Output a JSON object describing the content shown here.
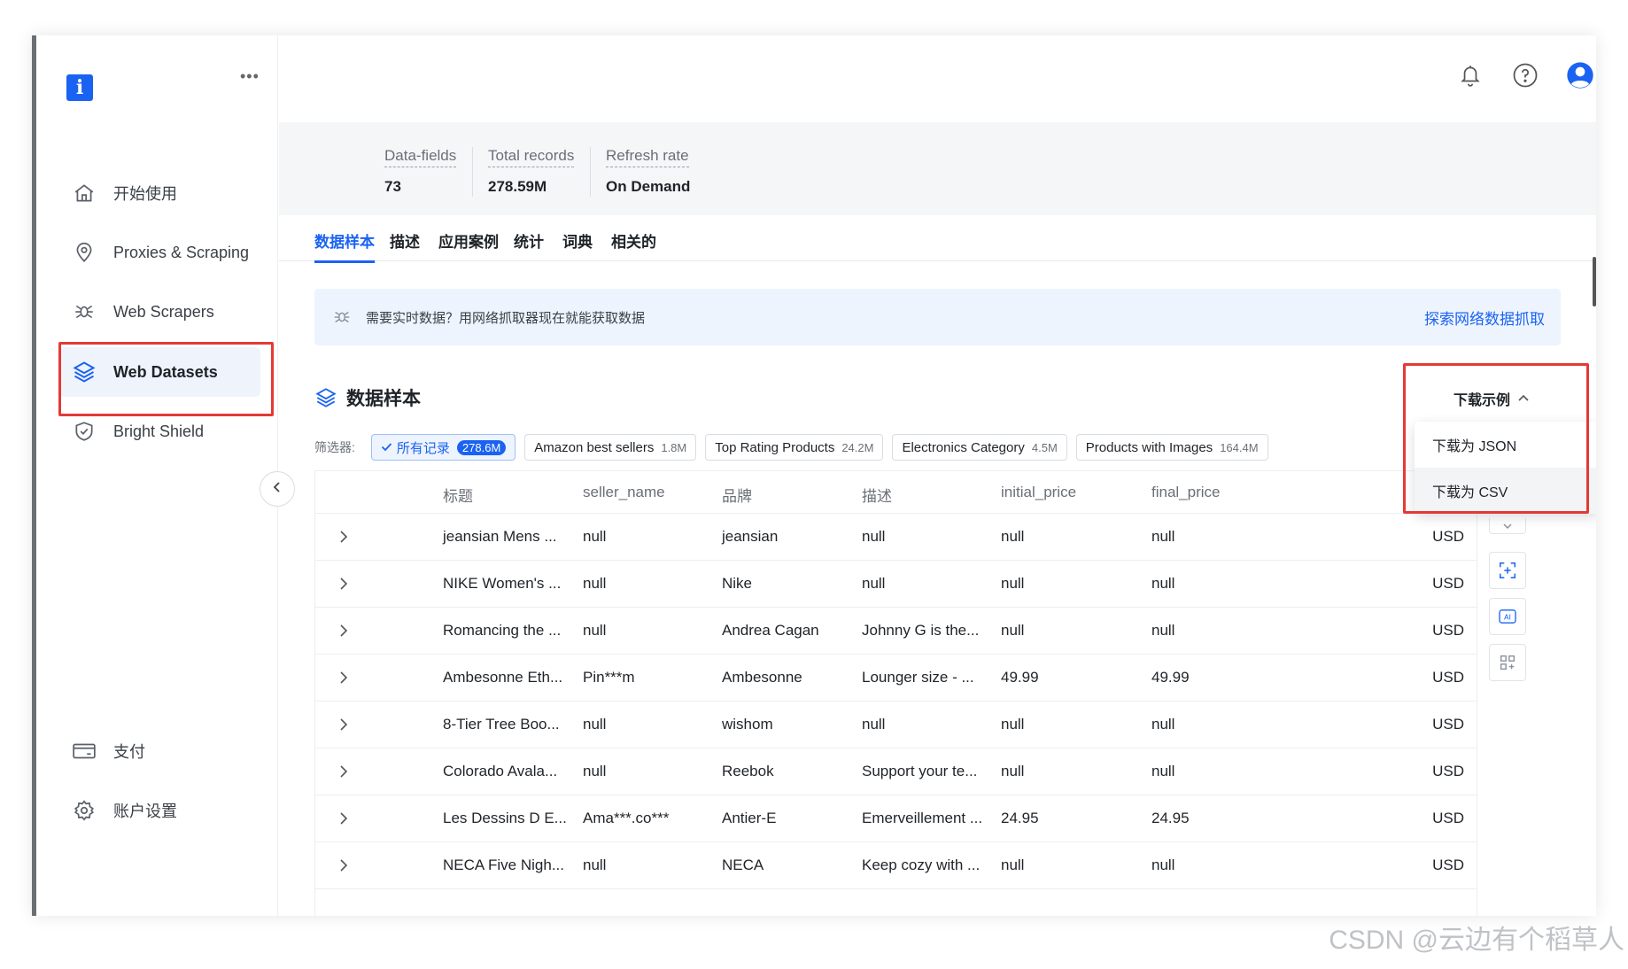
{
  "sidebar": {
    "logo": "i",
    "more": "•••",
    "items": [
      {
        "label": "开始使用",
        "icon": "home-icon"
      },
      {
        "label": "Proxies & Scraping",
        "icon": "location-pin-icon"
      },
      {
        "label": "Web Scrapers",
        "icon": "spider-icon"
      },
      {
        "label": "Web Datasets",
        "icon": "layers-icon",
        "active": true
      },
      {
        "label": "Bright Shield",
        "icon": "shield-check-icon"
      },
      {
        "label": "支付",
        "icon": "card-icon"
      },
      {
        "label": "账户设置",
        "icon": "gear-icon"
      }
    ]
  },
  "topbar": {
    "icons": [
      "bell-icon",
      "help-circle-icon",
      "user-avatar-icon"
    ]
  },
  "stats": [
    {
      "label": "Data-fields",
      "value": "73"
    },
    {
      "label": "Total records",
      "value": "278.59M"
    },
    {
      "label": "Refresh rate",
      "value": "On Demand"
    }
  ],
  "tabs": [
    {
      "label": "数据样本",
      "active": true
    },
    {
      "label": "描述"
    },
    {
      "label": "应用案例"
    },
    {
      "label": "统计"
    },
    {
      "label": "词典"
    },
    {
      "label": "相关的"
    }
  ],
  "banner": {
    "text": "需要实时数据？用网络抓取器现在就能获取数据",
    "link": "探索网络数据抓取"
  },
  "section": {
    "title": "数据样本"
  },
  "download": {
    "label": "下载示例",
    "options": [
      "下载为 JSON",
      "下载为 CSV"
    ]
  },
  "filters": {
    "label": "筛选器:",
    "chips": [
      {
        "label": "所有记录",
        "count": "278.6M",
        "active": true
      },
      {
        "label": "Amazon best sellers",
        "count": "1.8M"
      },
      {
        "label": "Top Rating Products",
        "count": "24.2M"
      },
      {
        "label": "Electronics Category",
        "count": "4.5M"
      },
      {
        "label": "Products with Images",
        "count": "164.4M"
      }
    ]
  },
  "table": {
    "columns": [
      "标题",
      "seller_name",
      "品牌",
      "描述",
      "initial_price",
      "final_price"
    ],
    "rows": [
      [
        "jeansian Mens ...",
        "null",
        "jeansian",
        "null",
        "null",
        "null",
        "USD"
      ],
      [
        "NIKE Women's ...",
        "null",
        "Nike",
        "null",
        "null",
        "null",
        "USD"
      ],
      [
        "Romancing the ...",
        "null",
        "Andrea Cagan",
        "Johnny G is the...",
        "null",
        "null",
        "USD"
      ],
      [
        "Ambesonne Eth...",
        "Pin***m",
        "Ambesonne",
        "Lounger size - ...",
        "49.99",
        "49.99",
        "USD"
      ],
      [
        "8-Tier Tree Boo...",
        "null",
        "wishom",
        "null",
        "null",
        "null",
        "USD"
      ],
      [
        "Colorado Avala...",
        "null",
        "Reebok",
        "Support your te...",
        "null",
        "null",
        "USD"
      ],
      [
        "Les Dessins D E...",
        "Ama***.co***",
        "Antier-E",
        "Emerveillement ...",
        "24.95",
        "24.95",
        "USD"
      ],
      [
        "NECA Five Nigh...",
        "null",
        "NECA",
        "Keep cozy with ...",
        "null",
        "null",
        "USD"
      ]
    ]
  },
  "tools": [
    "expand-icon",
    "scan-add-icon",
    "ai-icon",
    "grid-add-icon"
  ],
  "watermark": "CSDN @云边有个稻草人"
}
